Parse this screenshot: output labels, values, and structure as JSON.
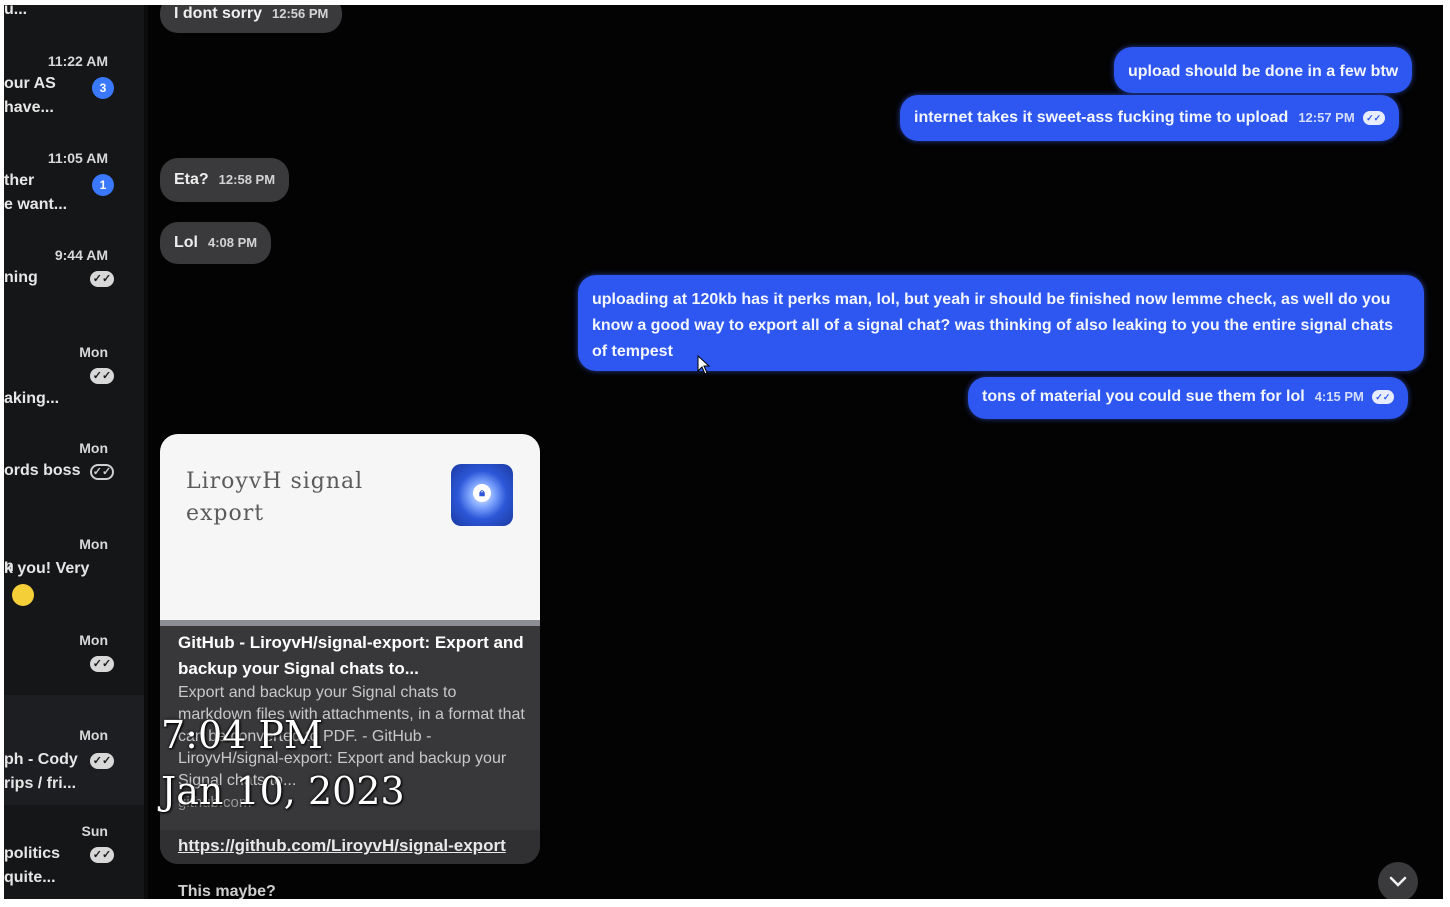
{
  "sidebar": {
    "top_fragment": "u...",
    "conversations": [
      {
        "time": "11:22 AM",
        "line1": "our AS",
        "line2": "have...",
        "badge": "3",
        "status": "unread"
      },
      {
        "time": "11:05 AM",
        "line1": "ther",
        "line2": "e want...",
        "badge": "1",
        "status": "unread"
      },
      {
        "time": "9:44 AM",
        "line1": "ning",
        "line2": "",
        "status": "read"
      },
      {
        "time": "Mon",
        "line1": "",
        "line2": "aking...",
        "status": "read"
      },
      {
        "time": "Mon",
        "line1": "ords boss",
        "line2": "",
        "status": "delivered"
      },
      {
        "time": "Mon",
        "line1": "n",
        "line2": "k you! Very",
        "status": "none"
      },
      {
        "time": "Mon",
        "line1": "",
        "line2": "",
        "status": "read"
      },
      {
        "time": "Mon",
        "line1": "ph - Cody",
        "line2": "rips / fri...",
        "status": "read"
      },
      {
        "time": "Sun",
        "line1": "politics",
        "line2": "quite...",
        "status": "read"
      }
    ]
  },
  "messages": {
    "m1": {
      "text": "I dont sorry",
      "time": "12:56 PM"
    },
    "m2": {
      "text": "upload should be done in a few btw"
    },
    "m3": {
      "text": "internet takes it sweet-ass fucking time to upload",
      "time": "12:57 PM"
    },
    "m4": {
      "text": "Eta?",
      "time": "12:58 PM"
    },
    "m5": {
      "text": "Lol",
      "time": "4:08 PM"
    },
    "m6": {
      "text": "uploading at 120kb has it perks man, lol, but yeah ir should be finished now lemme check, as well do you know a good way to export all of a signal chat? was thinking of also leaking to you the entire signal chats of tempest"
    },
    "m7": {
      "text": "tons of material you could sue them for lol",
      "time": "4:15 PM"
    }
  },
  "link_preview": {
    "image_title": "LiroyvH signal export",
    "title": "GitHub - LiroyvH/signal-export: Export and backup your Signal chats to...",
    "description": "Export and backup your Signal chats to markdown files with attachments, in a format that can be converted to PDF. - GitHub - LiroyvH/signal-export: Export and backup your Signal chats to...",
    "domain": "github.com",
    "url": "https://github.com/LiroyvH/signal-export",
    "follow_up": "This maybe?"
  },
  "overlay": {
    "time": "7:04 PM",
    "date": "Jan 10, 2023"
  },
  "icons": {
    "read_receipt": "double-check-icon",
    "scroll_down": "chevron-down-icon",
    "cursor": "mouse-cursor-icon"
  },
  "colors": {
    "outgoing_bubble": "#2d57f0",
    "incoming_bubble": "#3a3a3d",
    "unread_badge": "#3a78ff",
    "background": "#030303"
  }
}
